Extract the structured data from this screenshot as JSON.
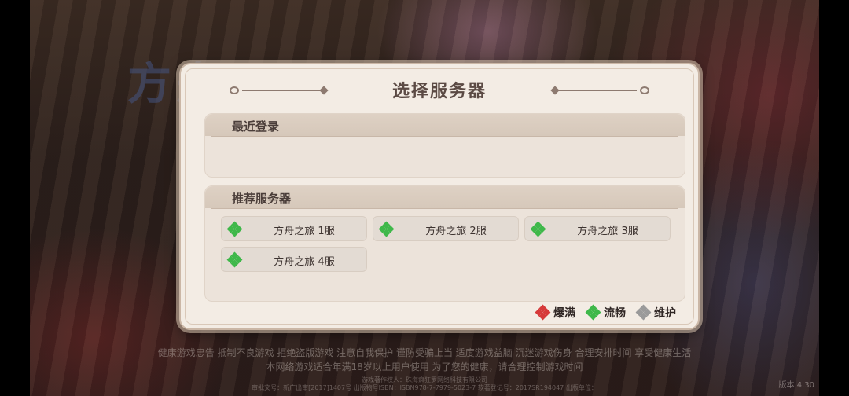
{
  "background": {
    "logo_text": "方舟"
  },
  "dialog": {
    "title": "选择服务器",
    "recent_section": {
      "title": "最近登录"
    },
    "recommend_section": {
      "title": "推荐服务器",
      "servers": [
        {
          "name": "方舟之旅 1服",
          "status": "流畅"
        },
        {
          "name": "方舟之旅 2服",
          "status": "流畅"
        },
        {
          "name": "方舟之旅 3服",
          "status": "流畅"
        },
        {
          "name": "方舟之旅 4服",
          "status": "流畅"
        }
      ]
    },
    "legend": [
      {
        "label": "爆满",
        "color": "#d63a3a"
      },
      {
        "label": "流畅",
        "color": "#3fb84a"
      },
      {
        "label": "维护",
        "color": "#9a9a9a"
      }
    ]
  },
  "footer": {
    "health_notice_line1": "健康游戏忠告  抵制不良游戏  拒绝盗版游戏  注意自我保护  谨防受骗上当  适度游戏益脑  沉迷游戏伤身  合理安排时间  享受健康生活",
    "health_notice_line2": "本网络游戏适合年满18岁以上用户使用   为了您的健康，请合理控制游戏时间",
    "publisher_line": "游戏著作权人：珠海疯狂罗网络科技有限公司",
    "approval_line": "审批文号：新广出审[2017]1407号   出版物号ISBN：ISBN978-7-7979-5023-7   软著登记号：2017SR194047   出版单位：",
    "version": "版本 4.30"
  },
  "colors": {
    "status_smooth": "#3fb84a",
    "status_full": "#d63a3a",
    "status_maintenance": "#9a9a9a"
  }
}
